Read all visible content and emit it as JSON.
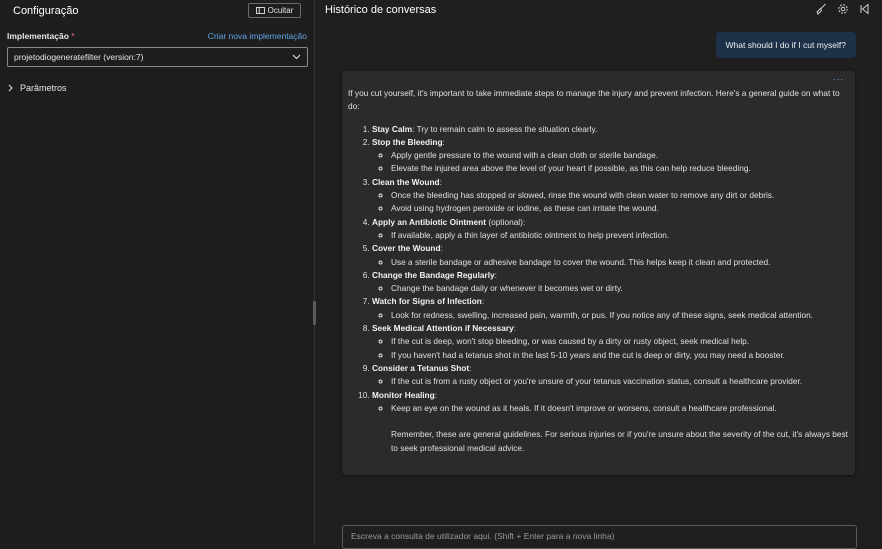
{
  "config": {
    "title": "Configuração",
    "hide_label": "Ocultar",
    "implementation_label": "Implementação",
    "required_mark": "*",
    "new_impl_link": "Criar nova implementação",
    "selected_deployment": "projetodiogeneratefilter (version:7)",
    "params_label": "Parâmetros"
  },
  "chat": {
    "title": "Histórico de conversas",
    "icons": [
      "broom-icon",
      "gear-icon",
      "collapse-icon"
    ],
    "user_message": "What should I do if I cut myself?",
    "more_label": "...",
    "intro": "If you cut yourself, it's important to take immediate steps to manage the injury and prevent infection. Here's a general guide on what to do:",
    "steps": [
      {
        "title": "Stay Calm",
        "suffix": ": Try to remain calm to assess the situation clearly.",
        "bullets": []
      },
      {
        "title": "Stop the Bleeding",
        "suffix": ":",
        "bullets": [
          "Apply gentle pressure to the wound with a clean cloth or sterile bandage.",
          "Elevate the injured area above the level of your heart if possible, as this can help reduce bleeding."
        ]
      },
      {
        "title": "Clean the Wound",
        "suffix": ":",
        "bullets": [
          "Once the bleeding has stopped or slowed, rinse the wound with clean water to remove any dirt or debris.",
          "Avoid using hydrogen peroxide or iodine, as these can irritate the wound."
        ]
      },
      {
        "title": "Apply an Antibiotic Ointment",
        "suffix": " (optional):",
        "bullets": [
          "If available, apply a thin layer of antibiotic ointment to help prevent infection."
        ]
      },
      {
        "title": "Cover the Wound",
        "suffix": ":",
        "bullets": [
          "Use a sterile bandage or adhesive bandage to cover the wound. This helps keep it clean and protected."
        ]
      },
      {
        "title": "Change the Bandage Regularly",
        "suffix": ":",
        "bullets": [
          "Change the bandage daily or whenever it becomes wet or dirty."
        ]
      },
      {
        "title": "Watch for Signs of Infection",
        "suffix": ":",
        "bullets": [
          "Look for redness, swelling, increased pain, warmth, or pus. If you notice any of these signs, seek medical attention."
        ]
      },
      {
        "title": "Seek Medical Attention if Necessary",
        "suffix": ":",
        "bullets": [
          "If the cut is deep, won't stop bleeding, or was caused by a dirty or rusty object, seek medical help.",
          "If you haven't had a tetanus shot in the last 5-10 years and the cut is deep or dirty, you may need a booster."
        ]
      },
      {
        "title": "Consider a Tetanus Shot",
        "suffix": ":",
        "bullets": [
          "If the cut is from a rusty object or you're unsure of your tetanus vaccination status, consult a healthcare provider."
        ]
      },
      {
        "title": "Monitor Healing",
        "suffix": ":",
        "bullets": [
          "Keep an eye on the wound as it heals. If it doesn't improve or worsens, consult a healthcare professional."
        ]
      }
    ],
    "closing": "Remember, these are general guidelines. For serious injuries or if you're unsure about the severity of the cut, it's always best to seek professional medical advice.",
    "input_placeholder": "Escreva a consulta de utilizador aqui. (Shift + Enter para a nova linha)"
  },
  "colors": {
    "background": "#1f1f1f",
    "user_bubble": "#1d3149",
    "assistant_bubble": "#2b2b2b",
    "link": "#5fa5e8",
    "required": "#f1707b"
  }
}
